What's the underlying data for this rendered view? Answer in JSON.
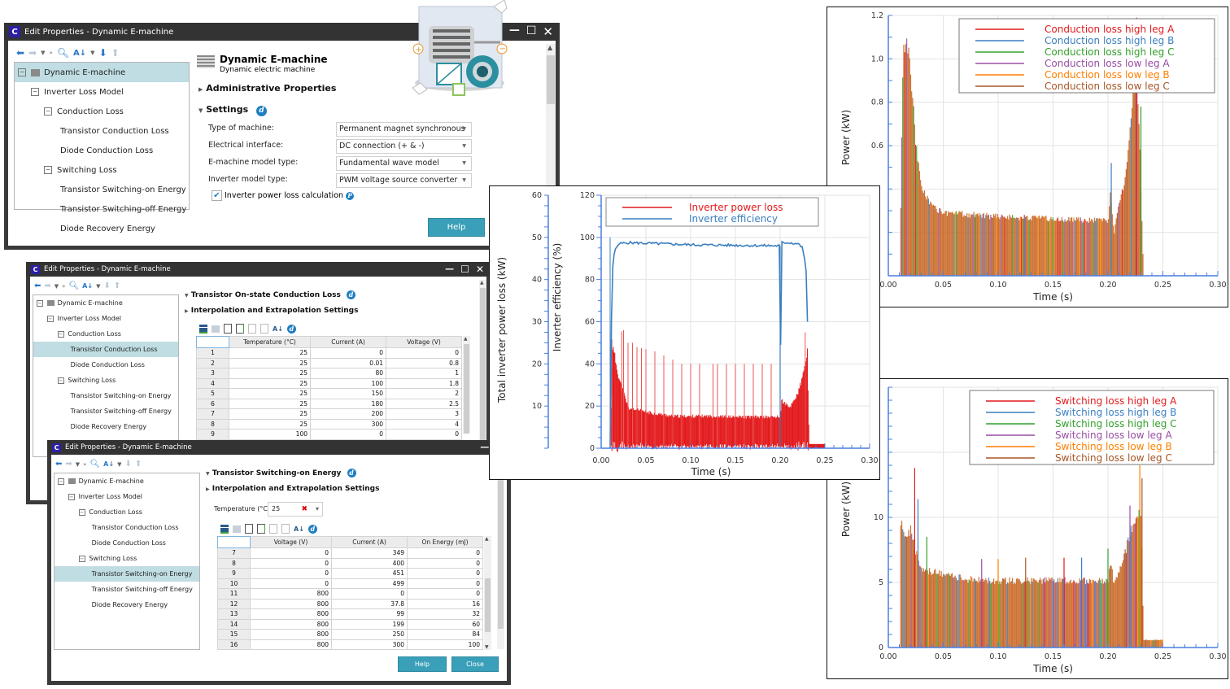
{
  "window1": {
    "title": "Edit Properties - Dynamic E-machine",
    "logo": "C",
    "controls": {
      "minimize": "—",
      "maximize": "☐",
      "close": "✕"
    },
    "tree": [
      {
        "label": "Dynamic E-machine",
        "level": 0,
        "expander": "⊟",
        "icon": true,
        "selected": true
      },
      {
        "label": "Inverter Loss Model",
        "level": 1,
        "expander": "⊟"
      },
      {
        "label": "Conduction Loss",
        "level": 2,
        "expander": "⊟"
      },
      {
        "label": "Transistor Conduction Loss",
        "level": 3
      },
      {
        "label": "Diode Conduction Loss",
        "level": 3
      },
      {
        "label": "Switching Loss",
        "level": 2,
        "expander": "⊟"
      },
      {
        "label": "Transistor Switching-on Energy",
        "level": 3
      },
      {
        "label": "Transistor Switching-off Energy",
        "level": 3
      },
      {
        "label": "Diode Recovery Energy",
        "level": 3
      }
    ],
    "header": {
      "title": "Dynamic E-machine",
      "subtitle": "Dynamic electric machine"
    },
    "admin_section": "Administrative Properties",
    "settings_section": "Settings",
    "fields": [
      {
        "label": "Type of machine:",
        "value": "Permanent magnet synchronous"
      },
      {
        "label": "Electrical interface:",
        "value": "DC connection (+ & -)"
      },
      {
        "label": "E-machine model type:",
        "value": "Fundamental wave model"
      },
      {
        "label": "Inverter model type:",
        "value": "PWM voltage source converter"
      }
    ],
    "checkbox": {
      "label": "Inverter power loss calculation",
      "checked": true
    },
    "help_button": "Help"
  },
  "window2": {
    "title": "Edit Properties - Dynamic E-machine",
    "logo": "C",
    "controls": {
      "minimize": "—",
      "maximize": "☐",
      "close": "✕"
    },
    "tree": [
      {
        "label": "Dynamic E-machine",
        "level": 0,
        "expander": "⊟",
        "icon": true
      },
      {
        "label": "Inverter Loss Model",
        "level": 1,
        "expander": "⊟"
      },
      {
        "label": "Conduction Loss",
        "level": 2,
        "expander": "⊟"
      },
      {
        "label": "Transistor Conduction Loss",
        "level": 3,
        "selected": true
      },
      {
        "label": "Diode Conduction Loss",
        "level": 3
      },
      {
        "label": "Switching Loss",
        "level": 2,
        "expander": "⊟"
      },
      {
        "label": "Transistor Switching-on Energy",
        "level": 3
      },
      {
        "label": "Transistor Switching-off Energy",
        "level": 3
      },
      {
        "label": "Diode Recovery Energy",
        "level": 3
      }
    ],
    "section": "Transistor On-state Conduction Loss",
    "interp_section": "Interpolation and Extrapolation Settings",
    "table": {
      "columns": [
        "Temperature (°C)",
        "Current (A)",
        "Voltage (V)"
      ],
      "rows": [
        [
          "1",
          "25",
          "0",
          "0"
        ],
        [
          "2",
          "25",
          "0.01",
          "0.8"
        ],
        [
          "3",
          "25",
          "80",
          "1"
        ],
        [
          "4",
          "25",
          "100",
          "1.8"
        ],
        [
          "5",
          "25",
          "150",
          "2"
        ],
        [
          "6",
          "25",
          "180",
          "2.5"
        ],
        [
          "7",
          "25",
          "200",
          "3"
        ],
        [
          "8",
          "25",
          "300",
          "4"
        ],
        [
          "9",
          "100",
          "0",
          "0"
        ]
      ]
    }
  },
  "window3": {
    "title": "Edit Properties - Dynamic E-machine",
    "logo": "C",
    "tree": [
      {
        "label": "Dynamic E-machine",
        "level": 0,
        "expander": "⊟",
        "icon": true
      },
      {
        "label": "Inverter Loss Model",
        "level": 1,
        "expander": "⊟"
      },
      {
        "label": "Conduction Loss",
        "level": 2,
        "expander": "⊟"
      },
      {
        "label": "Transistor Conduction Loss",
        "level": 3
      },
      {
        "label": "Diode Conduction Loss",
        "level": 3
      },
      {
        "label": "Switching Loss",
        "level": 2,
        "expander": "⊟"
      },
      {
        "label": "Transistor Switching-on Energy",
        "level": 3,
        "selected": true
      },
      {
        "label": "Transistor Switching-off Energy",
        "level": 3
      },
      {
        "label": "Diode Recovery Energy",
        "level": 3
      }
    ],
    "section": "Transistor Switching-on Energy",
    "interp_section": "Interpolation and Extrapolation Settings",
    "temperature": {
      "label": "Temperature (°C)",
      "value": "25",
      "clear": "✖",
      "arrow": "▾"
    },
    "table": {
      "columns": [
        "Voltage (V)",
        "Current (A)",
        "On Energy (mJ)"
      ],
      "rows": [
        [
          "7",
          "0",
          "349",
          "0"
        ],
        [
          "8",
          "0",
          "400",
          "0"
        ],
        [
          "9",
          "0",
          "451",
          "0"
        ],
        [
          "10",
          "0",
          "499",
          "0"
        ],
        [
          "11",
          "800",
          "0",
          "0"
        ],
        [
          "12",
          "800",
          "37.8",
          "16"
        ],
        [
          "13",
          "800",
          "99",
          "32"
        ],
        [
          "14",
          "800",
          "199",
          "60"
        ],
        [
          "15",
          "800",
          "250",
          "84"
        ],
        [
          "16",
          "800",
          "300",
          "100"
        ]
      ]
    },
    "help_button": "Help",
    "close_button": "Close"
  },
  "toolbar_icons": [
    "back-arrow",
    "forward-arrow",
    "dropdown",
    "expand-all",
    "search",
    "sort",
    "dropdown",
    "move-down",
    "move-up"
  ],
  "grid_tool_icons": [
    "add-row",
    "delete-row",
    "import",
    "export",
    "copy",
    "paste",
    "sort",
    "info"
  ],
  "chart_data": [
    {
      "id": "inverter",
      "type": "line",
      "title": "",
      "xlabel": "Time (s)",
      "ylabel_left_outer": "Total inverter power loss (kW)",
      "ylabel_left_inner": "Inverter efficiency (%)",
      "xlim": [
        0,
        0.3
      ],
      "ylim_outer": [
        0,
        60
      ],
      "ylim_inner": [
        0,
        120
      ],
      "x_ticks": [
        "0.00",
        "0.05",
        "0.10",
        "0.15",
        "0.20",
        "0.25",
        "0.30"
      ],
      "y_ticks_outer": [
        "10",
        "20",
        "30",
        "40",
        "50",
        "60"
      ],
      "y_ticks_inner": [
        "0",
        "20",
        "40",
        "60",
        "80",
        "100",
        "120"
      ],
      "grid": true,
      "legend_position": "top",
      "series": [
        {
          "name": "Inverter power loss",
          "color": "#e31a1c",
          "axis": "outer",
          "x": [
            0.01,
            0.012,
            0.02,
            0.03,
            0.05,
            0.08,
            0.1,
            0.12,
            0.15,
            0.18,
            0.2,
            0.201,
            0.21,
            0.22,
            0.225,
            0.23,
            0.232,
            0.25
          ],
          "envelope": [
            0,
            25.8,
            17,
            10,
            9,
            8,
            8,
            8,
            7.8,
            7.8,
            7.8,
            12,
            10,
            14,
            18,
            24,
            1,
            1
          ]
        },
        {
          "name": "Inverter efficiency",
          "color": "#3b7fc0",
          "axis": "inner",
          "x": [
            0.01,
            0.012,
            0.015,
            0.02,
            0.03,
            0.1,
            0.2,
            0.2,
            0.201,
            0.21,
            0.22,
            0.225,
            0.228,
            0.23,
            0.232
          ],
          "y": [
            0,
            82,
            94,
            97,
            97.5,
            96.5,
            96,
            0,
            97.5,
            97.5,
            97,
            95,
            88,
            80,
            0
          ]
        }
      ]
    },
    {
      "id": "conduction",
      "type": "area",
      "title": "",
      "xlabel": "Time (s)",
      "ylabel": "Power (kW)",
      "xlim": [
        0,
        0.3
      ],
      "ylim": [
        0,
        1.2
      ],
      "x_ticks": [
        "0.00",
        "0.05",
        "0.10",
        "0.15",
        "0.20",
        "0.25",
        "0.30"
      ],
      "y_ticks": [
        "0.6",
        "0.8",
        "1.0",
        "1.2"
      ],
      "grid": true,
      "legend_position": "top-right",
      "series": [
        {
          "name": "Conduction loss high leg A",
          "color": "#e31a1c"
        },
        {
          "name": "Conduction loss high leg B",
          "color": "#3b7fc0"
        },
        {
          "name": "Conduction loss high leg C",
          "color": "#33a02c"
        },
        {
          "name": "Conduction loss low leg A",
          "color": "#984ea3"
        },
        {
          "name": "Conduction loss low leg B",
          "color": "#ff7f00"
        },
        {
          "name": "Conduction loss low leg C",
          "color": "#a65628"
        }
      ],
      "envelope": {
        "x": [
          0.01,
          0.013,
          0.016,
          0.02,
          0.025,
          0.03,
          0.04,
          0.05,
          0.1,
          0.15,
          0.2,
          0.202,
          0.205,
          0.21,
          0.215,
          0.22,
          0.225,
          0.228,
          0.232
        ],
        "y": [
          0,
          1.1,
          1.14,
          0.95,
          0.6,
          0.42,
          0.33,
          0.3,
          0.28,
          0.27,
          0.26,
          0.4,
          0.2,
          0.35,
          0.45,
          0.7,
          1.0,
          0.7,
          0
        ]
      }
    },
    {
      "id": "switching",
      "type": "area",
      "title": "",
      "xlabel": "Time (s)",
      "ylabel": "Power (kW)",
      "xlim": [
        0,
        0.3
      ],
      "ylim": [
        0,
        20
      ],
      "x_ticks": [
        "0.00",
        "0.05",
        "0.10",
        "0.15",
        "0.20",
        "0.25",
        "0.30"
      ],
      "y_ticks": [
        "0",
        "5",
        "10"
      ],
      "grid": true,
      "legend_position": "top-right",
      "series": [
        {
          "name": "Switching loss high leg A",
          "color": "#e31a1c"
        },
        {
          "name": "Switching loss high leg B",
          "color": "#3b7fc0"
        },
        {
          "name": "Switching loss high leg C",
          "color": "#33a02c"
        },
        {
          "name": "Switching loss low leg A",
          "color": "#984ea3"
        },
        {
          "name": "Switching loss low leg B",
          "color": "#ff7f00"
        },
        {
          "name": "Switching loss low leg C",
          "color": "#a65628"
        }
      ],
      "envelope": {
        "x": [
          0.01,
          0.011,
          0.015,
          0.02,
          0.025,
          0.03,
          0.04,
          0.05,
          0.07,
          0.1,
          0.15,
          0.2,
          0.202,
          0.205,
          0.21,
          0.215,
          0.22,
          0.226,
          0.23,
          0.232,
          0.25
        ],
        "y": [
          0,
          10.3,
          9,
          9.2,
          7.5,
          6,
          6,
          5.8,
          5.4,
          5.3,
          5.3,
          5.3,
          7,
          5,
          6,
          7.5,
          9,
          10.8,
          10,
          0.6,
          0.6
        ]
      }
    }
  ]
}
